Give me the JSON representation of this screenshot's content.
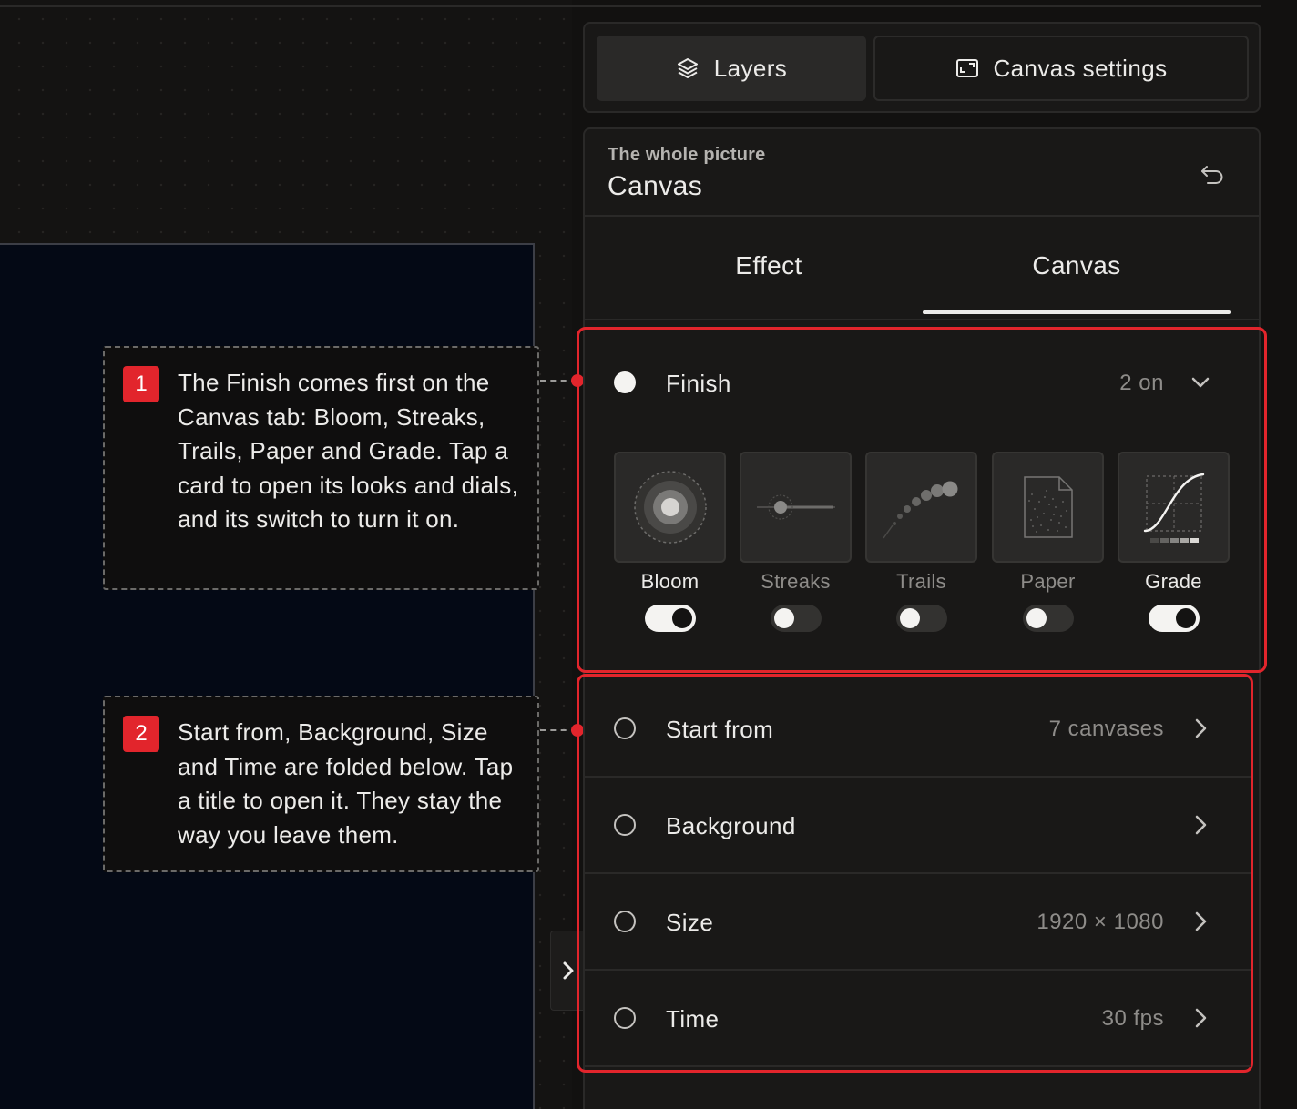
{
  "top_tabs": {
    "layers_label": "Layers",
    "canvas_settings_label": "Canvas settings"
  },
  "panel": {
    "subtitle": "The whole picture",
    "title": "Canvas",
    "tabs": [
      {
        "label": "Effect",
        "active": false
      },
      {
        "label": "Canvas",
        "active": true
      }
    ]
  },
  "finish": {
    "title": "Finish",
    "value": "2 on",
    "cards": [
      {
        "label": "Bloom",
        "on": true,
        "icon": "bloom-icon"
      },
      {
        "label": "Streaks",
        "on": false,
        "icon": "streaks-icon"
      },
      {
        "label": "Trails",
        "on": false,
        "icon": "trails-icon"
      },
      {
        "label": "Paper",
        "on": false,
        "icon": "paper-icon"
      },
      {
        "label": "Grade",
        "on": true,
        "icon": "grade-curve-icon"
      }
    ]
  },
  "folded_sections": [
    {
      "title": "Start from",
      "value": "7 canvases"
    },
    {
      "title": "Background",
      "value": ""
    },
    {
      "title": "Size",
      "value": "1920 × 1080"
    },
    {
      "title": "Time",
      "value": "30 fps"
    }
  ],
  "callouts": [
    {
      "number": "1",
      "text": "The Finish comes first on the Canvas tab: Bloom, Streaks, Trails, Paper and Grade. Tap a card to open its looks and dials, and its switch to turn it on."
    },
    {
      "number": "2",
      "text": "Start from, Background, Size and Time are folded below. Tap a title to open it. They stay the way you leave them."
    }
  ],
  "colors": {
    "accent_red": "#e2252c",
    "panel_bg": "#191817",
    "artboard_bg": "#040915",
    "text_primary": "#ecebe9",
    "text_muted": "#8e8c89"
  }
}
